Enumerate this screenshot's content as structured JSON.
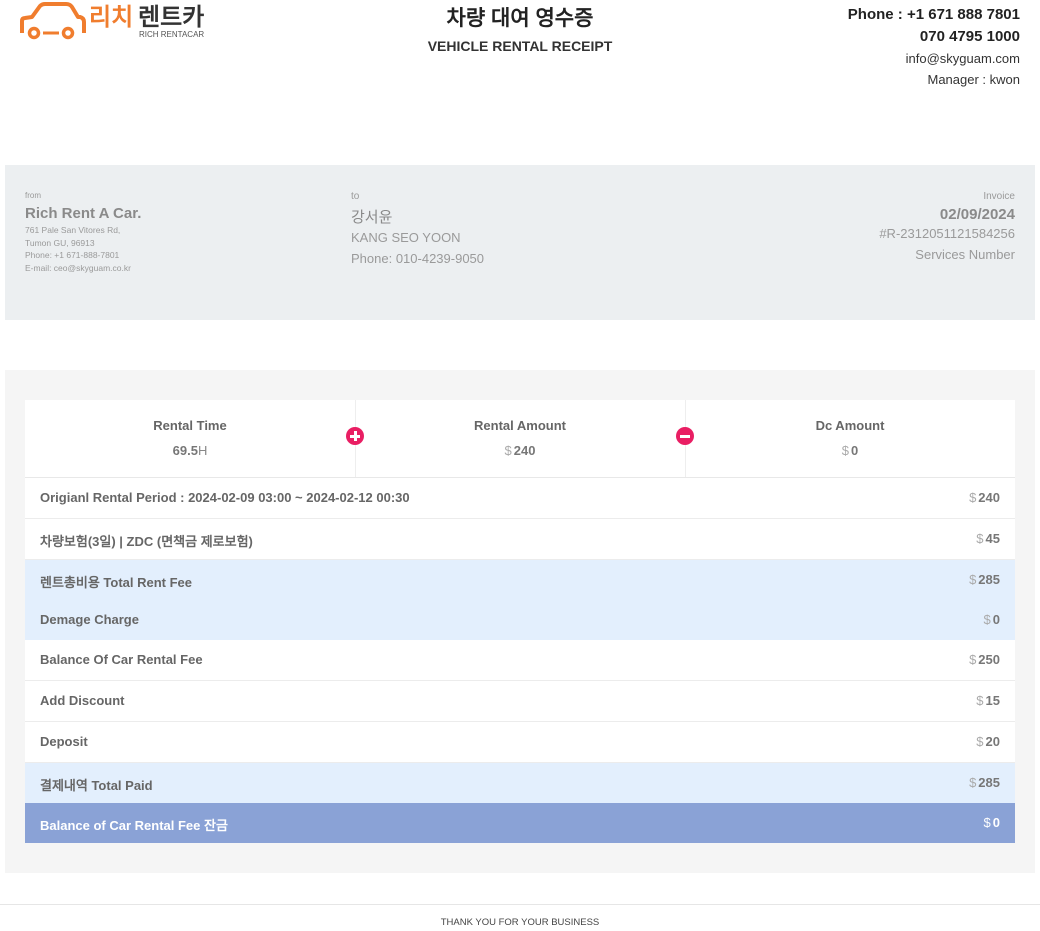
{
  "brand": {
    "logo_ko": "리치렌트카",
    "logo_en": "RICH RENTACAR",
    "accent": "#f07d2e"
  },
  "header": {
    "title_ko": "차량 대여 영수증",
    "title_en": "VEHICLE RENTAL RECEIPT",
    "phone1": "Phone : +1 671 888 7801",
    "phone2": "070 4795 1000",
    "email": "info@skyguam.com",
    "manager": "Manager : kwon"
  },
  "from": {
    "caption": "from",
    "name": "Rich Rent A Car.",
    "address1": "761 Pale San Vitores Rd,",
    "address2": "Tumon GU, 96913",
    "phone": "Phone: +1 671-888-7801",
    "email": "E-mail: ceo@skyguam.co.kr"
  },
  "to": {
    "caption": "to",
    "name_ko": "강서윤",
    "name_en": "KANG SEO YOON",
    "phone": "Phone: 010-4239-9050"
  },
  "invoice": {
    "caption": "Invoice",
    "date": "02/09/2024",
    "number": "#R-2312051121584256",
    "number_label": "Services Number"
  },
  "summary": {
    "rental_time_label": "Rental Time",
    "rental_time_value": "69.5",
    "rental_time_unit": "H",
    "rental_amount_label": "Rental Amount",
    "rental_amount_currency": "$",
    "rental_amount_value": "240",
    "dc_amount_label": "Dc Amount",
    "dc_amount_currency": "$",
    "dc_amount_value": "0",
    "plus_icon": "plus-circle-icon",
    "minus_icon": "minus-circle-icon",
    "icon_color": "#e91e63"
  },
  "rows": [
    {
      "label": "Origianl Rental Period : 2024-02-09 03:00 ~ 2024-02-12 00:30",
      "currency": "$",
      "amount": "240"
    },
    {
      "label": "차량보험(3일) | ZDC (면책금 제로보험)",
      "currency": "$",
      "amount": "45"
    },
    {
      "label": "렌트총비용 Total Rent Fee",
      "currency": "$",
      "amount": "285"
    },
    {
      "label": "Demage Charge",
      "currency": "$",
      "amount": "0"
    },
    {
      "label": "Balance Of Car Rental Fee",
      "currency": "$",
      "amount": "250"
    },
    {
      "label": "Add Discount",
      "currency": "$",
      "amount": "15"
    },
    {
      "label": "Deposit",
      "currency": "$",
      "amount": "20"
    },
    {
      "label": "결제내역 Total Paid",
      "currency": "$",
      "amount": "285"
    },
    {
      "label": "Balance of Car Rental Fee 잔금",
      "currency": "$",
      "amount": "0"
    }
  ],
  "footer": {
    "text": "THANK YOU FOR YOUR BUSINESS"
  }
}
